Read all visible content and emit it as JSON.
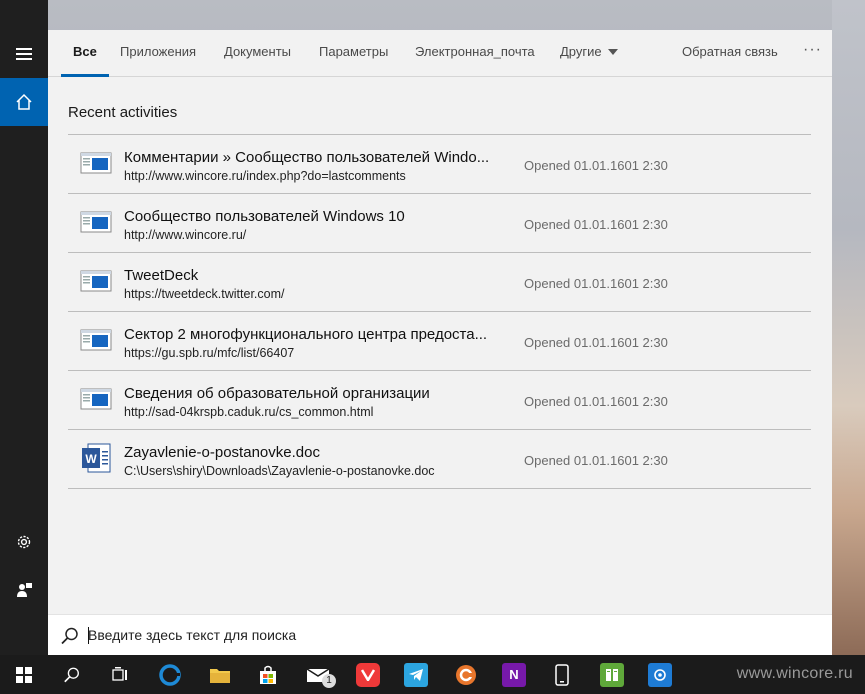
{
  "rail": {
    "icons": [
      "hamburger-icon",
      "home-icon",
      "gear-icon",
      "feedback-icon"
    ]
  },
  "tabs": {
    "all": "Все",
    "apps": "Приложения",
    "documents": "Документы",
    "settings": "Параметры",
    "email": "Электронная_почта",
    "other": "Другие",
    "feedback": "Обратная связь",
    "more": "···"
  },
  "recent": {
    "title": "Recent activities",
    "items": [
      {
        "title": "Комментарии » Сообщество пользователей Windo...",
        "url": "http://www.wincore.ru/index.php?do=lastcomments",
        "meta": "Opened 01.01.1601 2:30",
        "icon": "webpage-icon"
      },
      {
        "title": "Сообщество пользователей Windows 10",
        "url": "http://www.wincore.ru/",
        "meta": "Opened 01.01.1601 2:30",
        "icon": "webpage-icon"
      },
      {
        "title": "TweetDeck",
        "url": "https://tweetdeck.twitter.com/",
        "meta": "Opened 01.01.1601 2:30",
        "icon": "webpage-icon"
      },
      {
        "title": "Сектор 2 многофункционального центра предоста...",
        "url": "https://gu.spb.ru/mfc/list/66407",
        "meta": "Opened 01.01.1601 2:30",
        "icon": "webpage-icon"
      },
      {
        "title": "Сведения об образовательной организации",
        "url": "http://sad-04krspb.caduk.ru/cs_common.html",
        "meta": "Opened 01.01.1601 2:30",
        "icon": "webpage-icon"
      },
      {
        "title": "Zayavlenie-o-postanovke.doc",
        "url": "C:\\Users\\shiry\\Downloads\\Zayavlenie-o-postanovke.doc",
        "meta": "Opened 01.01.1601 2:30",
        "icon": "word-doc-icon"
      }
    ]
  },
  "search": {
    "placeholder": "Введите здесь текст для поиска"
  },
  "taskbar": {
    "mail_badge": "1",
    "onenote_letter": "N",
    "watermark": "www.wincore.ru",
    "colors": {
      "accent": "#0063b1",
      "edge": "#1e8ad6",
      "vivaldi": "#ef3939",
      "telegram": "#2ca5e0",
      "onenote": "#7719aa"
    }
  }
}
